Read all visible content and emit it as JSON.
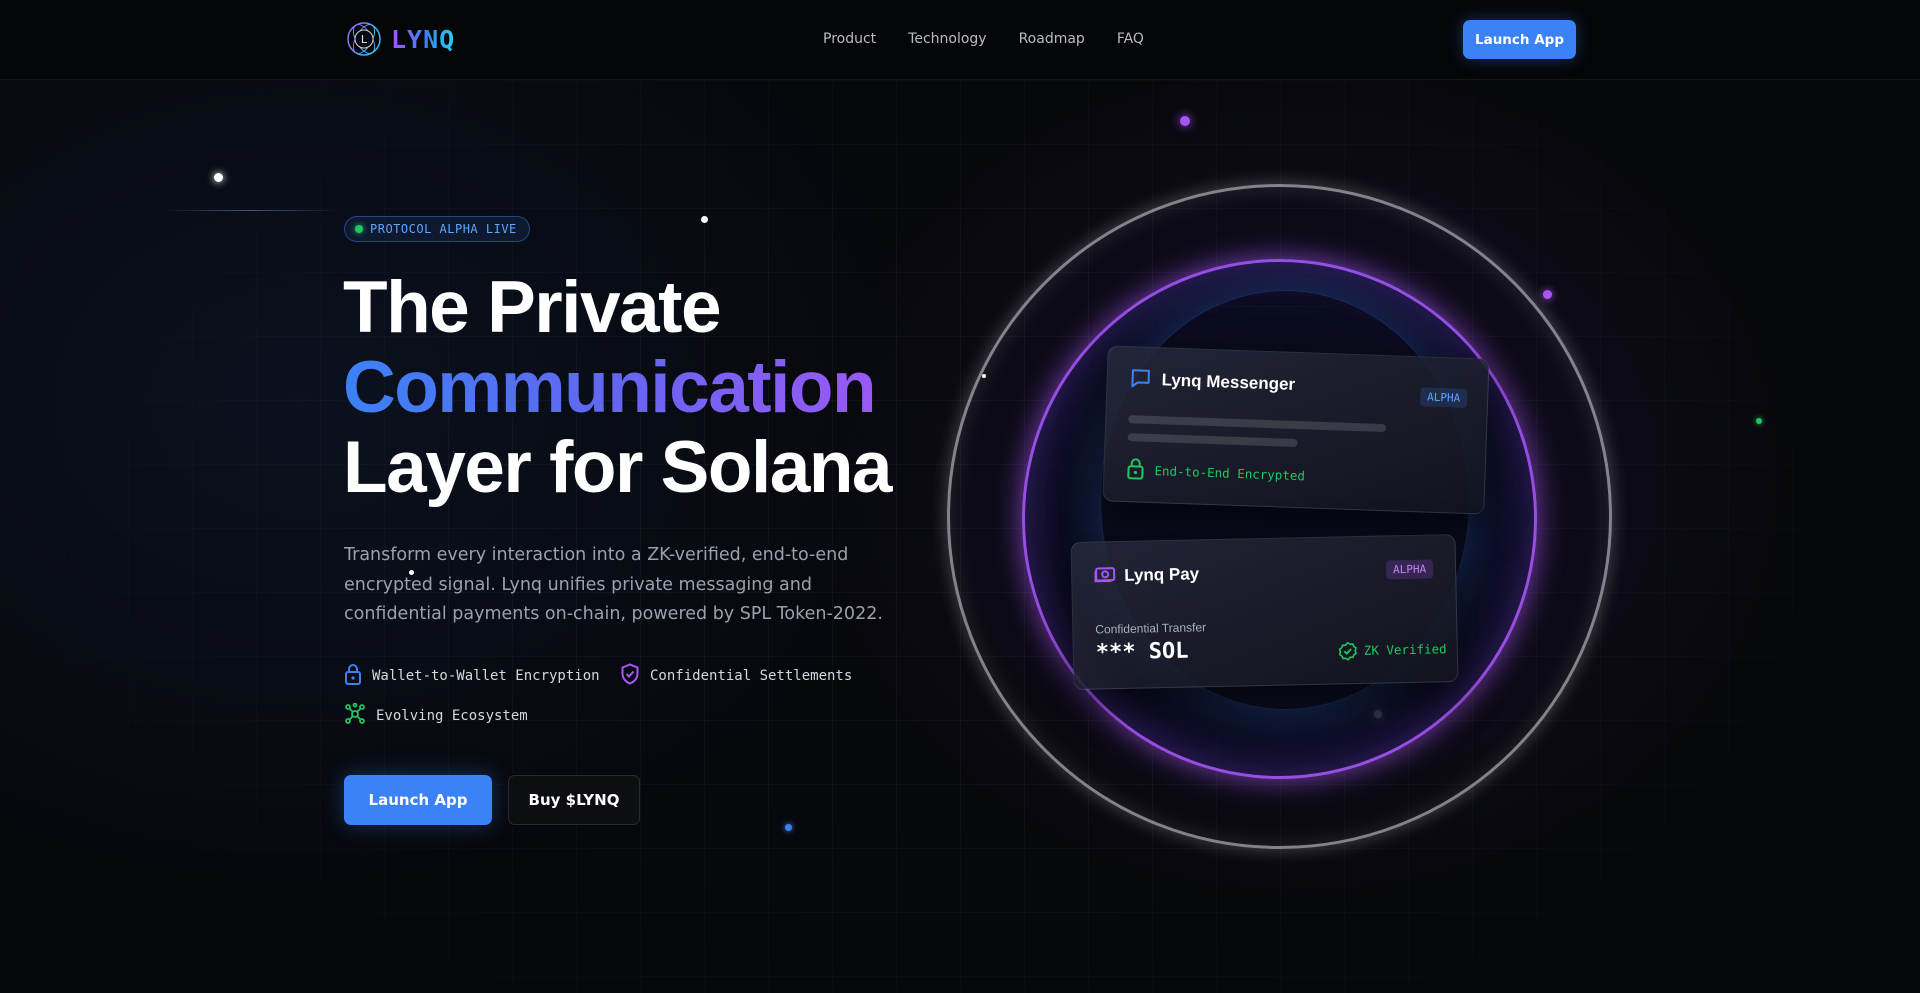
{
  "brand": {
    "name": "LYNQ",
    "mark_letter": "L"
  },
  "nav": {
    "links": [
      "Product",
      "Technology",
      "Roadmap",
      "FAQ"
    ],
    "cta_label": "Launch App"
  },
  "hero": {
    "badge": "PROTOCOL ALPHA LIVE",
    "headline": {
      "line1": "The Private",
      "line2": "Communication",
      "line3": "Layer for Solana"
    },
    "description": "Transform every interaction into a ZK-verified, end-to-end encrypted signal. Lynq unifies private messaging and confidential payments on-chain, powered by SPL Token-2022.",
    "features": [
      {
        "label": "Wallet-to-Wallet Encryption",
        "icon": "lock-icon"
      },
      {
        "label": "Confidential Settlements",
        "icon": "shield-check-icon"
      },
      {
        "label": "Evolving Ecosystem",
        "icon": "network-icon"
      }
    ],
    "primary_cta": "Launch App",
    "secondary_cta": "Buy $LYNQ"
  },
  "cards": {
    "messenger": {
      "title": "Lynq Messenger",
      "tag": "ALPHA",
      "status": "End-to-End Encrypted"
    },
    "pay": {
      "title": "Lynq Pay",
      "tag": "ALPHA",
      "label": "Confidential Transfer",
      "amount": "*** SOL",
      "status": "ZK Verified"
    }
  },
  "colors": {
    "accent_blue": "#3b82f6",
    "accent_purple": "#a855f7",
    "success_green": "#22c55e",
    "background": "#07080c"
  }
}
